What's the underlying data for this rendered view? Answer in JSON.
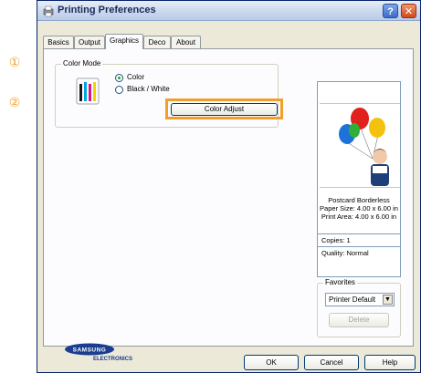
{
  "annotations": {
    "marker_1": "①",
    "marker_2": "②"
  },
  "window": {
    "title": "Printing Preferences",
    "help_glyph": "?",
    "close_glyph": "✕"
  },
  "tabs": [
    {
      "label": "Basics"
    },
    {
      "label": "Output"
    },
    {
      "label": "Graphics",
      "active": true
    },
    {
      "label": "Deco"
    },
    {
      "label": "About"
    }
  ],
  "color_mode": {
    "group_label": "Color Mode",
    "options": [
      {
        "label": "Color",
        "checked": true
      },
      {
        "label": "Black / White",
        "checked": false
      }
    ],
    "adjust_button": "Color Adjust",
    "highlight_color": "#f0a02a"
  },
  "preview": {
    "line1": "Postcard Borderless",
    "line2": "Paper Size: 4.00 x 6.00 in",
    "line3": "Print Area: 4.00 x 6.00 in",
    "copies": "Copies: 1",
    "quality": "Quality: Normal"
  },
  "favorites": {
    "group_label": "Favorites",
    "selected": "Printer Default",
    "delete_button": "Delete"
  },
  "brand": {
    "line1": "SAMSUNG",
    "line2": "ELECTRONICS",
    "color": "#1a3d8f"
  },
  "footer": {
    "ok": "OK",
    "cancel": "Cancel",
    "help": "Help"
  }
}
